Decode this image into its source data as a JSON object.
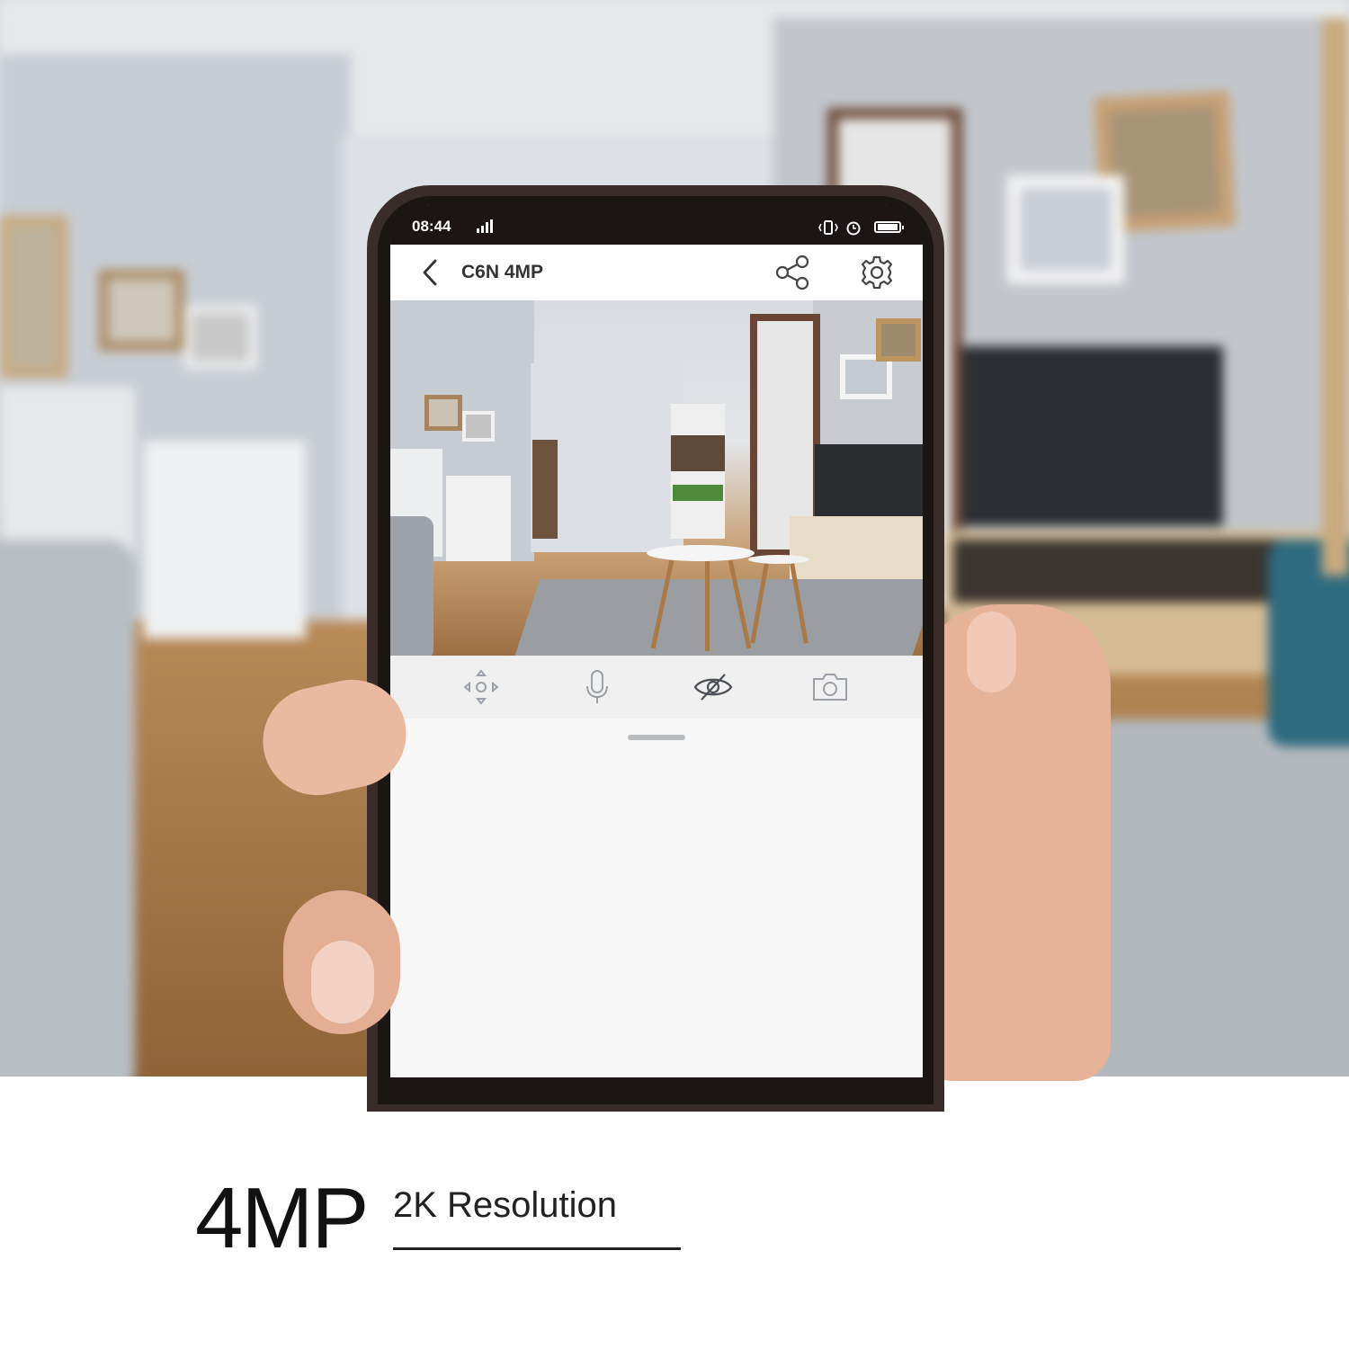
{
  "statusbar": {
    "time": "08:44",
    "signal_icon": "signal-bars-icon",
    "vibrate_icon": "vibrate-icon",
    "alarm_icon": "alarm-icon",
    "battery_icon": "battery-icon"
  },
  "appbar": {
    "title": "C6N 4MP",
    "back_icon": "chevron-left-icon",
    "share_icon": "share-icon",
    "settings_icon": "gear-icon"
  },
  "live_view": {
    "description_icon": "camera-feed"
  },
  "controls": [
    {
      "icon": "pan-tilt-icon"
    },
    {
      "icon": "microphone-icon"
    },
    {
      "icon": "privacy-eye-off-icon"
    },
    {
      "icon": "snapshot-camera-icon"
    }
  ],
  "caption": {
    "headline": "4MP",
    "subline": "2K Resolution"
  },
  "colors": {
    "appbar_bg": "#ffffff",
    "controls_bg": "#f0f0f0",
    "icon_color": "#9aa0a6",
    "title_color": "#333333",
    "caption_color": "#111111"
  }
}
